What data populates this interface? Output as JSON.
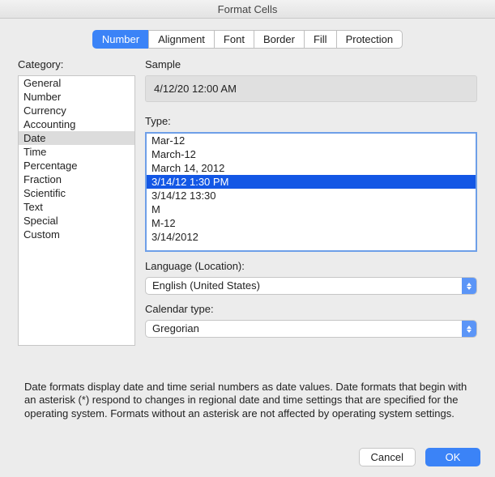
{
  "window": {
    "title": "Format Cells"
  },
  "tabs": {
    "number": "Number",
    "alignment": "Alignment",
    "font": "Font",
    "border": "Border",
    "fill": "Fill",
    "protection": "Protection"
  },
  "labels": {
    "category": "Category:",
    "sample": "Sample",
    "type": "Type:",
    "language": "Language (Location):",
    "calendar": "Calendar type:"
  },
  "categories": {
    "items": [
      "General",
      "Number",
      "Currency",
      "Accounting",
      "Date",
      "Time",
      "Percentage",
      "Fraction",
      "Scientific",
      "Text",
      "Special",
      "Custom"
    ],
    "selected_index": 4
  },
  "sample_value": "4/12/20 12:00 AM",
  "type_options": {
    "visible": [
      "Mar-12",
      "March-12",
      "March 14, 2012",
      "3/14/12 1:30 PM",
      "3/14/12 13:30",
      "M",
      "M-12",
      "3/14/2012"
    ],
    "selected_index": 3
  },
  "language": {
    "value": "English (United States)"
  },
  "calendar": {
    "value": "Gregorian"
  },
  "description": "Date formats display date and time serial numbers as date values.  Date formats that begin with an asterisk (*) respond to changes in regional date and time settings that are specified for the operating system. Formats without an asterisk are not affected by operating system settings.",
  "buttons": {
    "cancel": "Cancel",
    "ok": "OK"
  }
}
